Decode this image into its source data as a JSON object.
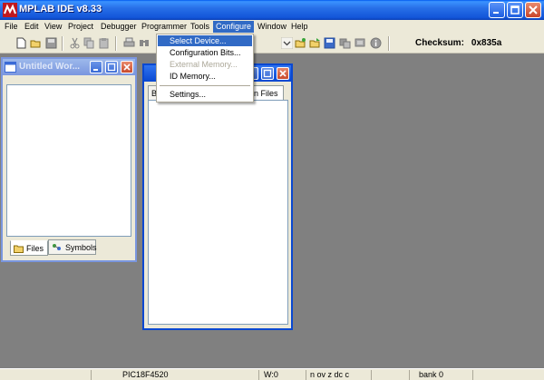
{
  "window": {
    "title": "MPLAB IDE v8.33"
  },
  "menu": {
    "items": [
      "File",
      "Edit",
      "View",
      "Project",
      "Debugger",
      "Programmer",
      "Tools",
      "Configure",
      "Window",
      "Help"
    ],
    "active": "Configure"
  },
  "configure_menu": {
    "items": [
      {
        "label": "Select Device...",
        "state": "highlighted"
      },
      {
        "label": "Configuration Bits...",
        "state": "enabled"
      },
      {
        "label": "External Memory...",
        "state": "disabled"
      },
      {
        "label": "ID Memory...",
        "state": "enabled"
      },
      {
        "label": "Settings...",
        "state": "enabled"
      }
    ]
  },
  "toolbar": {
    "checksum_label": "Checksum:",
    "checksum_value": "0x835a"
  },
  "workspace_window": {
    "title": "Untitled Wor...",
    "tabs": [
      "Files",
      "Symbols"
    ]
  },
  "project_window": {
    "tab_left_fragment": "B",
    "tab_right_fragment": "n Files"
  },
  "status": {
    "device": "PIC18F4520",
    "w": "W:0",
    "flags": "n ov z dc c",
    "bank": "bank 0"
  },
  "colors": {
    "titlebar": "#0a48d1",
    "menu_highlight": "#316ac5",
    "mdi_background": "#808080",
    "chrome": "#ece9d8"
  }
}
